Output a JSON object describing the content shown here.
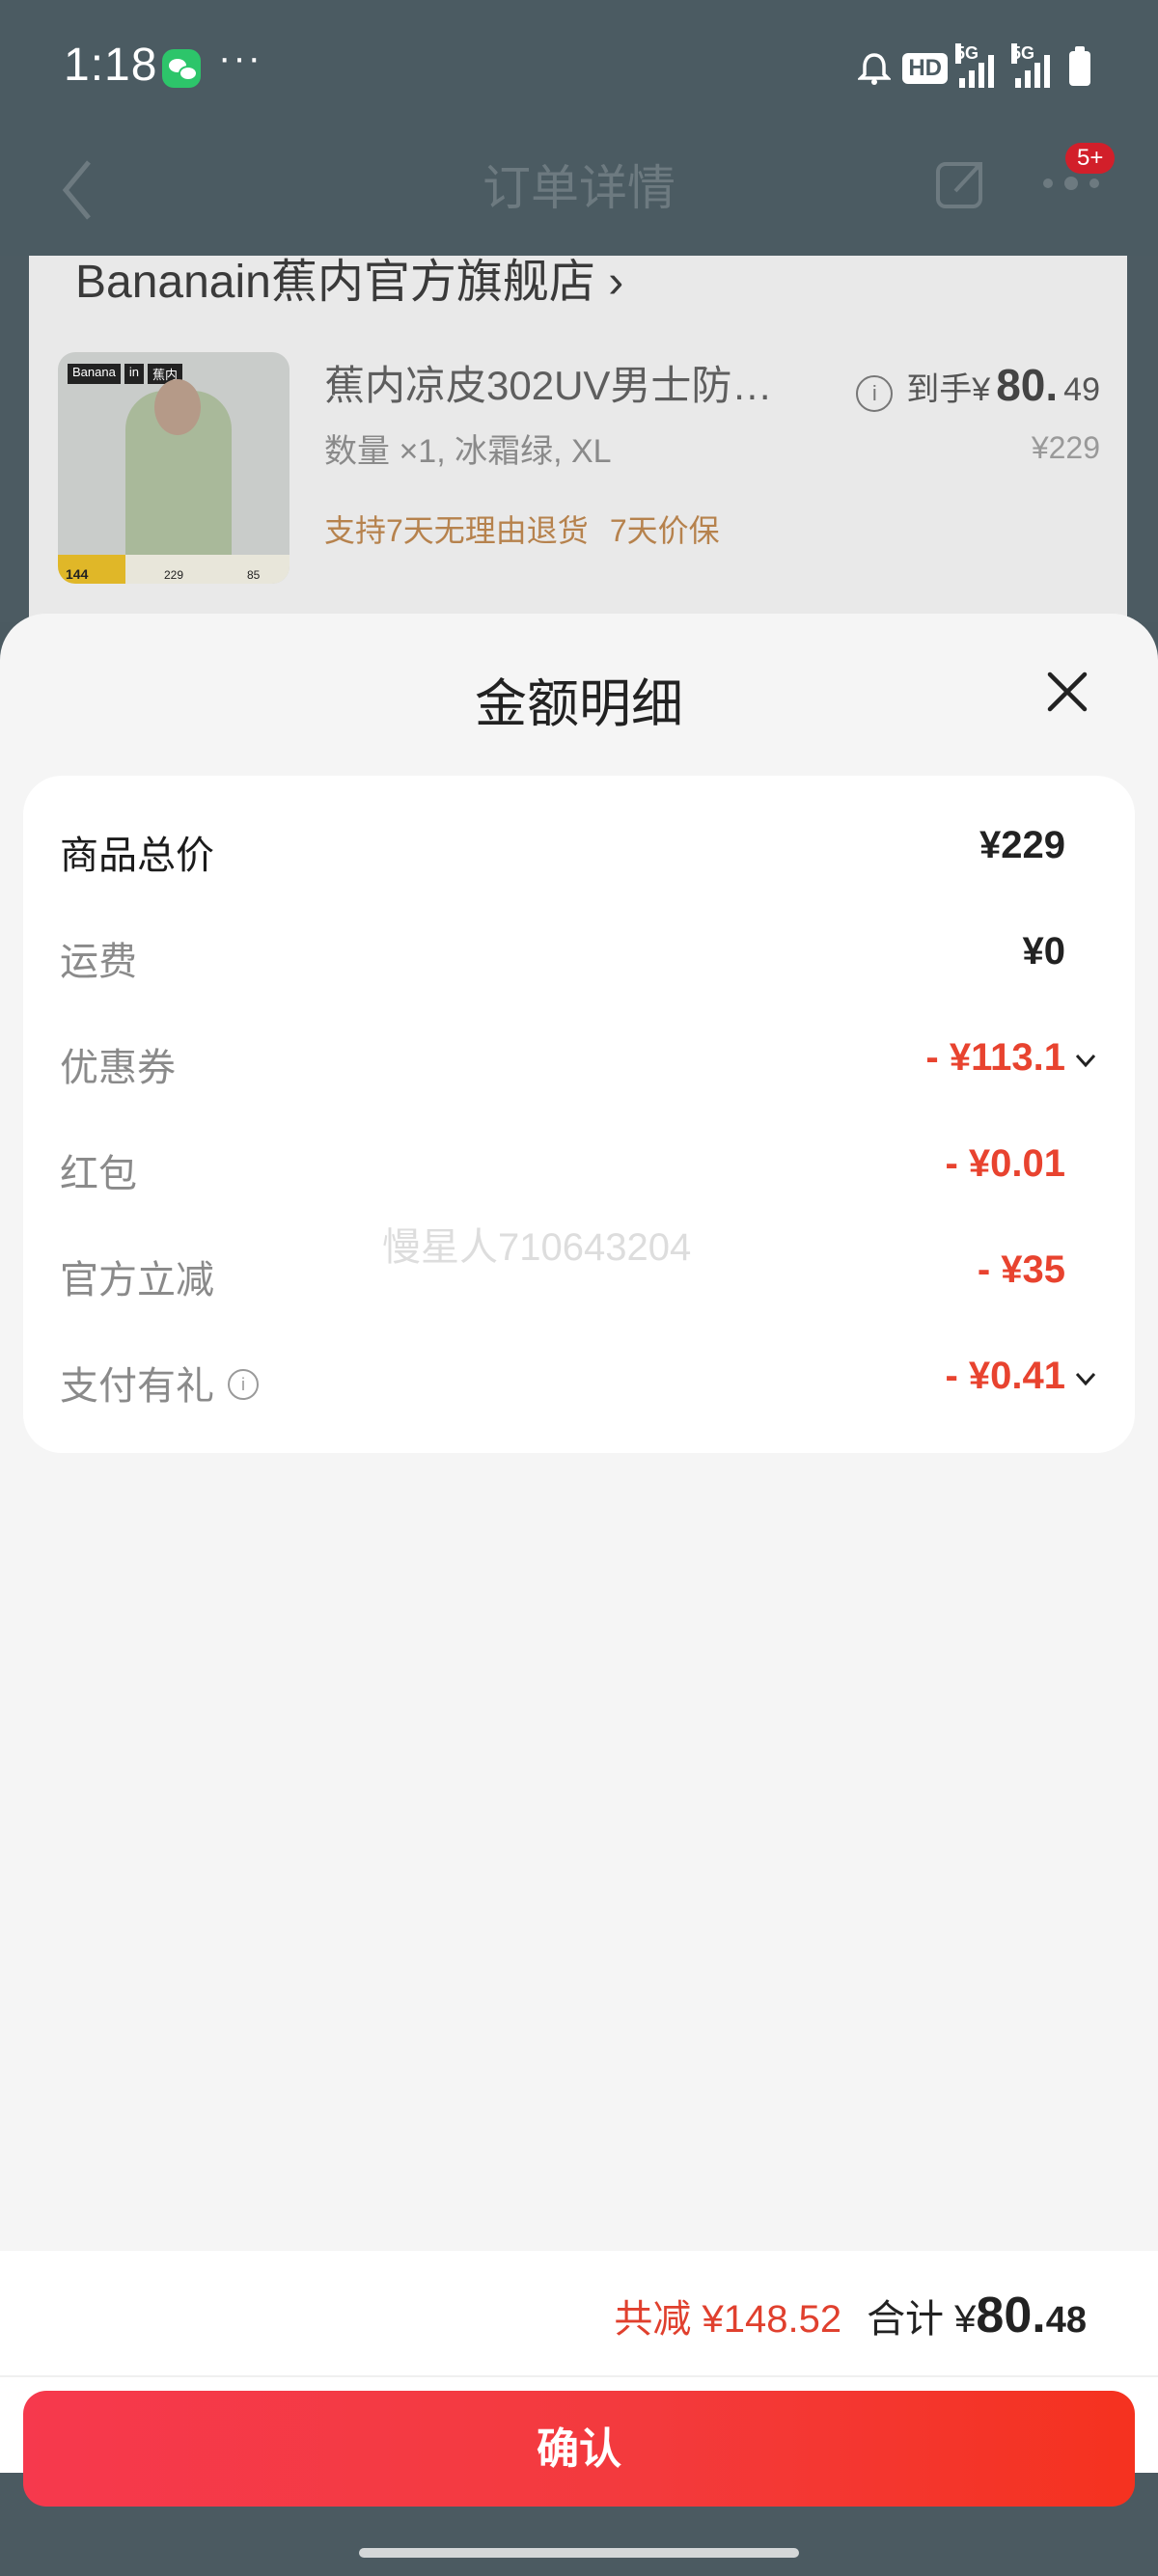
{
  "status_bar": {
    "time": "1:18",
    "dots": "···",
    "hd": "HD",
    "net1": "5G",
    "net2": "5G"
  },
  "nav": {
    "title": "订单详情",
    "badge": "5+"
  },
  "order": {
    "store_name": "Bananain蕉内官方旗舰店 ›",
    "product_title": "蕉内凉皮302UV男士防…",
    "spec": "数量 ×1, 冰霜绿, XL",
    "tags": [
      "支持7天无理由退货",
      "7天价保"
    ],
    "price_prefix": "到手¥",
    "price_int": "80.",
    "price_dec": "49",
    "original_price": "¥229",
    "img_tag": [
      "Banana",
      "in",
      "蕉内"
    ],
    "img_strip": [
      "144",
      "229",
      "85"
    ]
  },
  "sheet": {
    "title": "金额明细",
    "rows": [
      {
        "label": "商品总价",
        "value": "¥229",
        "red": false
      },
      {
        "label": "运费",
        "value": "¥0",
        "red": false
      },
      {
        "label": "优惠券",
        "value": "- ¥113.1",
        "red": true
      },
      {
        "label": "红包",
        "value": "- ¥0.01",
        "red": true
      },
      {
        "label": "官方立减",
        "value": "- ¥35",
        "red": true
      },
      {
        "label": "支付有礼",
        "value": "- ¥0.41",
        "red": true
      }
    ],
    "watermark": "慢星人710643204"
  },
  "footer": {
    "reduce": "共减 ¥148.52",
    "total_label": "合计 ¥",
    "total_int": "80.",
    "total_dec": "48",
    "confirm_label": "确认"
  },
  "colors": {
    "accent": "#f33a3d",
    "discount": "#e8432f"
  }
}
